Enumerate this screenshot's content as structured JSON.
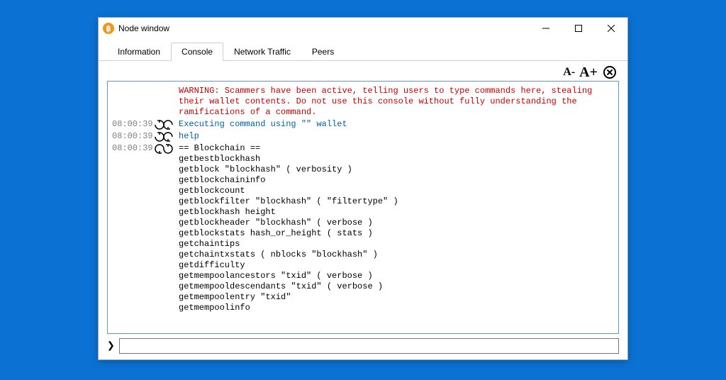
{
  "window": {
    "title": "Node window"
  },
  "tabs": [
    {
      "label": "Information",
      "active": false
    },
    {
      "label": "Console",
      "active": true
    },
    {
      "label": "Network Traffic",
      "active": false
    },
    {
      "label": "Peers",
      "active": false
    }
  ],
  "font_controls": {
    "decrease": "A-",
    "increase": "A+"
  },
  "console": {
    "warning": "WARNING: Scammers have been active, telling users to type commands here, stealing their wallet contents. Do not use this console without fully understanding the ramifications of a command.",
    "rows": [
      {
        "ts": "08:00:39",
        "dir": "in",
        "kind": "exec",
        "text": "Executing command using \"\" wallet"
      },
      {
        "ts": "08:00:39",
        "dir": "in",
        "kind": "cmd",
        "text": "help"
      },
      {
        "ts": "08:00:39",
        "dir": "out",
        "kind": "out",
        "text": "== Blockchain ==\ngetbestblockhash\ngetblock \"blockhash\" ( verbosity )\ngetblockchaininfo\ngetblockcount\ngetblockfilter \"blockhash\" ( \"filtertype\" )\ngetblockhash height\ngetblockheader \"blockhash\" ( verbose )\ngetblockstats hash_or_height ( stats )\ngetchaintips\ngetchaintxstats ( nblocks \"blockhash\" )\ngetdifficulty\ngetmempoolancestors \"txid\" ( verbose )\ngetmempooldescendants \"txid\" ( verbose )\ngetmempoolentry \"txid\"\ngetmempoolinfo"
      }
    ]
  },
  "input": {
    "value": ""
  }
}
